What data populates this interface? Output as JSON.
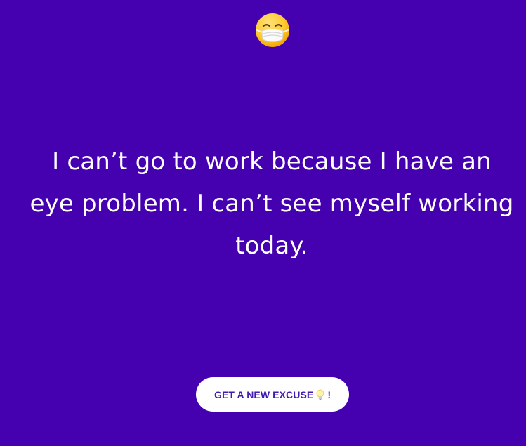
{
  "header": {
    "emoji_icon": "face-with-medical-mask-icon"
  },
  "main": {
    "excuse_text": "I can’t go to work because I have an eye problem. I can’t see myself working today."
  },
  "action": {
    "button_label": "GET A NEW EXCUSE",
    "button_icon": "light-bulb-icon",
    "button_suffix": "!"
  },
  "colors": {
    "background": "#4500b0",
    "text": "#ffffff",
    "button_background": "#ffffff",
    "button_text": "#3f1bb0"
  }
}
